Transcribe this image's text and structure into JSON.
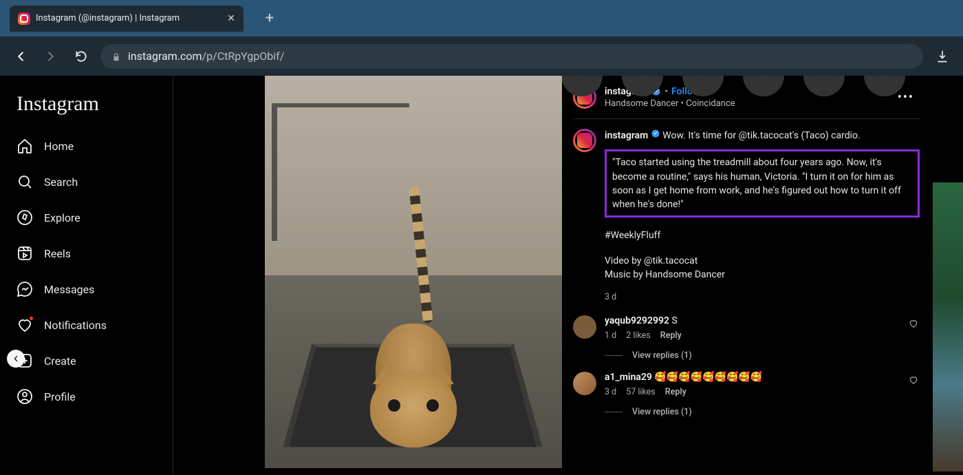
{
  "browser": {
    "tab_title": "Instagram (@instagram) | Instagram",
    "url_host": "instagram.com",
    "url_path": "/p/CtRpYgpObif/"
  },
  "sidebar": {
    "logo": "Instagram",
    "items": [
      {
        "label": "Home"
      },
      {
        "label": "Search"
      },
      {
        "label": "Explore"
      },
      {
        "label": "Reels"
      },
      {
        "label": "Messages"
      },
      {
        "label": "Notifications"
      },
      {
        "label": "Create"
      },
      {
        "label": "Profile"
      }
    ]
  },
  "post": {
    "author": "instagram",
    "follow": "Follow",
    "music": "Handsome Dancer • Coincidance",
    "caption_lead": "Wow. It's time for @tik.tacocat's (Taco) cardio.",
    "caption_highlight": "\"Taco started using the treadmill about four years ago. Now, it's become a routine,\" says his human, Victoria. \"I turn it on for him as soon as I get home from work, and he's figured out how to turn it off when he's done!\"",
    "hashtag": "#WeeklyFluff",
    "credit_video": "Video by @tik.tacocat",
    "credit_music": "Music by Handsome Dancer",
    "time": "3 d"
  },
  "comments": [
    {
      "user": "yaqub9292992",
      "text": "S",
      "time": "1 d",
      "likes": "2 likes",
      "reply": "Reply",
      "view_replies": "View replies (1)"
    },
    {
      "user": "a1_mina29",
      "text": "🥰🥰🥰🥰🥰🥰🥰🥰🥰",
      "time": "3 d",
      "likes": "57 likes",
      "reply": "Reply",
      "view_replies": "View replies (1)"
    }
  ],
  "labels": {
    "reply": "Reply"
  }
}
